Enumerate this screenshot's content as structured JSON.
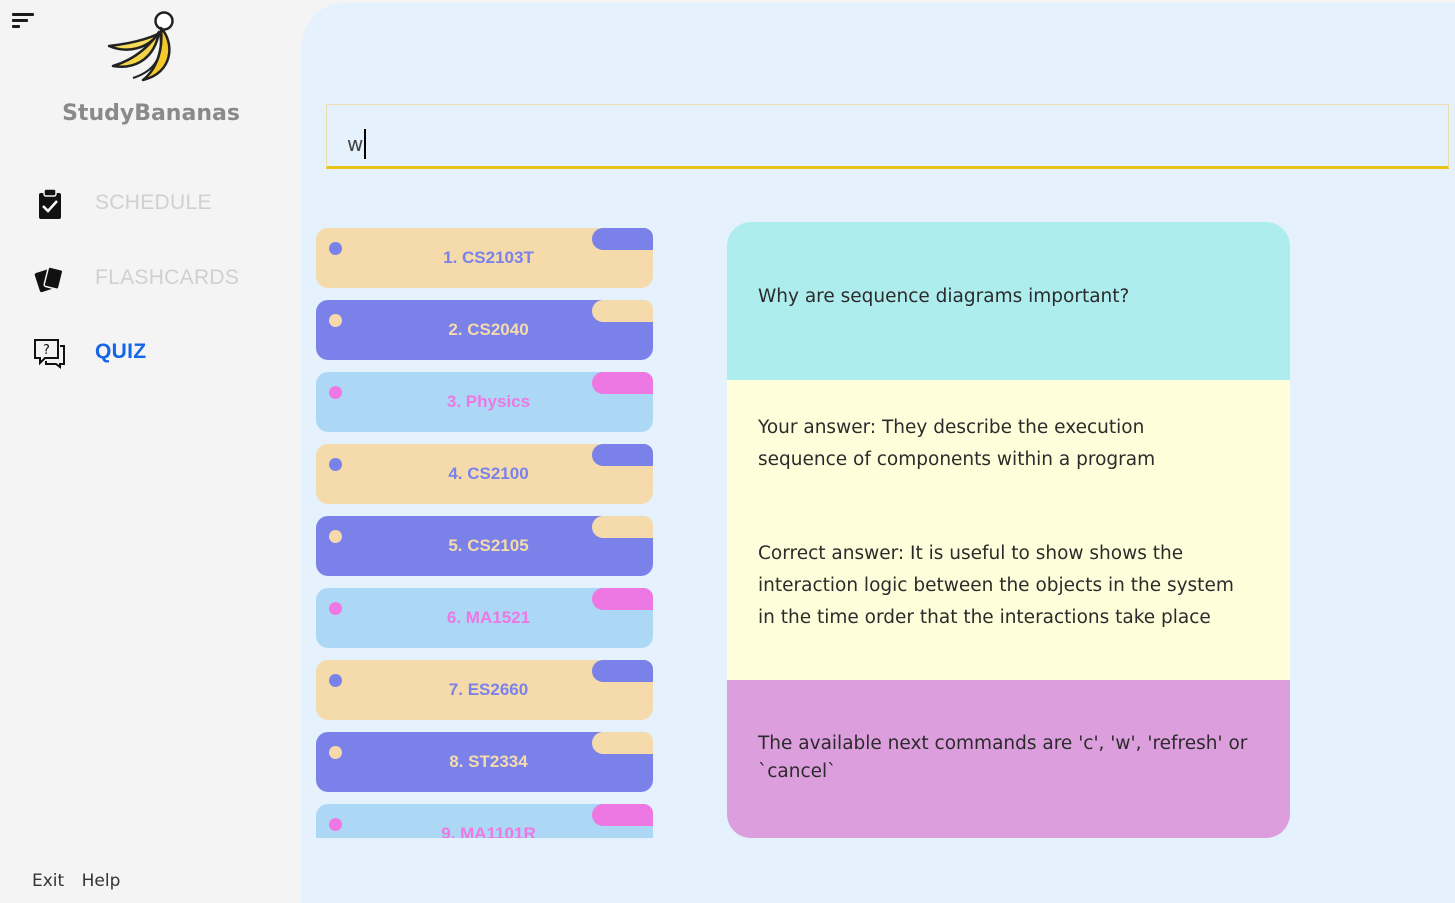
{
  "app": {
    "name": "StudyBananas"
  },
  "sidebar": {
    "items": [
      {
        "label": "SCHEDULE",
        "icon": "clipboard-check-icon",
        "active": false
      },
      {
        "label": "FLASHCARDS",
        "icon": "cards-icon",
        "active": false
      },
      {
        "label": "QUIZ",
        "icon": "question-chat-icon",
        "active": true
      }
    ],
    "footer": {
      "exit_label": "Exit",
      "help_label": "Help"
    }
  },
  "command": {
    "value": "w"
  },
  "modules": [
    {
      "label": "1. CS2103T",
      "style": "tan"
    },
    {
      "label": "2. CS2040",
      "style": "blue"
    },
    {
      "label": "3. Physics",
      "style": "sky"
    },
    {
      "label": "4. CS2100",
      "style": "tan"
    },
    {
      "label": "5. CS2105",
      "style": "blue"
    },
    {
      "label": "6. MA1521",
      "style": "sky"
    },
    {
      "label": "7. ES2660",
      "style": "tan"
    },
    {
      "label": "8. ST2334",
      "style": "blue"
    },
    {
      "label": "9. MA1101R",
      "style": "sky"
    }
  ],
  "quiz": {
    "question": "Why are sequence diagrams important?",
    "your_answer_line1": "Your answer: They describe the execution",
    "your_answer_line2": "sequence of components within a program",
    "correct_answer_line1": "Correct answer: It is useful to show shows the",
    "correct_answer_line2": "interaction logic between the objects in the system",
    "correct_answer_line3": "in the time order that the interactions take place",
    "commands_line1": "The available next commands are 'c', 'w', 'refresh' or",
    "commands_line2": "`cancel`"
  },
  "colors": {
    "accent_blue": "#1565e6",
    "module_tan": "#f5dbac",
    "module_blue": "#7a82ea",
    "module_sky": "#acd7f5",
    "module_pink": "#ee78e3",
    "question_bg": "#aeedee",
    "answer_bg": "#fefedb",
    "commands_bg": "#dc9edd",
    "input_underline": "#ebc316"
  }
}
